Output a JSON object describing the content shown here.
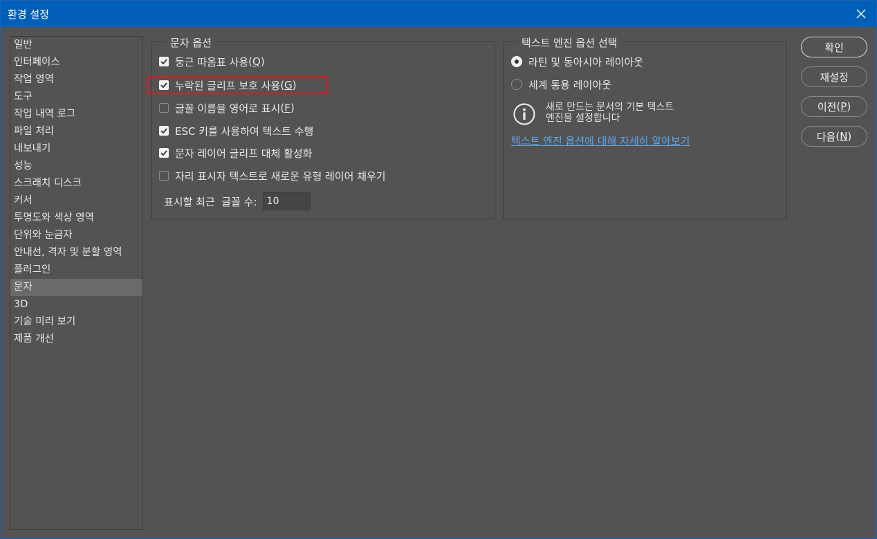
{
  "window": {
    "title": "환경 설정"
  },
  "sidebar": {
    "items": [
      {
        "label": "일반"
      },
      {
        "label": "인터페이스"
      },
      {
        "label": "작업 영역"
      },
      {
        "label": "도구"
      },
      {
        "label": "작업 내역 로그"
      },
      {
        "label": "파일 처리"
      },
      {
        "label": "내보내기"
      },
      {
        "label": "성능"
      },
      {
        "label": "스크래치 디스크"
      },
      {
        "label": "커서"
      },
      {
        "label": "투명도와 색상 영역"
      },
      {
        "label": "단위와 눈금자"
      },
      {
        "label": "안내선, 격자 및 분할 영역"
      },
      {
        "label": "플러그인"
      },
      {
        "label": "문자",
        "selected": true
      },
      {
        "label": "3D"
      },
      {
        "label": "기술 미리 보기"
      },
      {
        "label": "제품 개선"
      }
    ]
  },
  "type_options": {
    "legend": "문자 옵션",
    "options": [
      {
        "label": "둥근 따옴표 사용",
        "shortcut": "Q",
        "checked": true
      },
      {
        "label": "누락된 글리프 보호 사용",
        "shortcut": "G",
        "checked": true,
        "highlighted": true
      },
      {
        "label": "글꼴 이름을 영어로 표시",
        "shortcut": "F",
        "checked": false
      },
      {
        "label": "ESC 키를 사용하여 텍스트 수행",
        "shortcut": "",
        "checked": true
      },
      {
        "label": "문자 레이어 글리프 대체 활성화",
        "shortcut": "",
        "checked": true
      },
      {
        "label": "자리 표시자 텍스트로 새로운 유형 레이어 채우기",
        "shortcut": "",
        "checked": false
      }
    ],
    "recent_fonts_label": "표시할 최근  글꼴 수:",
    "recent_fonts_value": "10"
  },
  "engine_options": {
    "legend": "텍스트 엔진 옵션 선택",
    "radios": [
      {
        "label": "라틴 및 동아시아 레이아웃",
        "selected": true
      },
      {
        "label": "세계 통용 레이아웃",
        "selected": false
      }
    ],
    "info_line1": "새로 만드는 문서의 기본 텍스트",
    "info_line2": "엔진을 설정합니다",
    "learn_more": "텍스트 엔진 옵션에 대해 자세히 알아보기"
  },
  "buttons": {
    "ok": "확인",
    "reset": "재설정",
    "prev_label": "이전",
    "prev_shortcut": "P",
    "next_label": "다음",
    "next_shortcut": "N"
  },
  "colors": {
    "titlebar": "#005fb8",
    "background": "#535353",
    "link": "#5aa6f0",
    "highlight": "#e0191b"
  },
  "icons": {
    "close": "close-icon",
    "info": "info-icon",
    "check": "checkmark-icon"
  }
}
